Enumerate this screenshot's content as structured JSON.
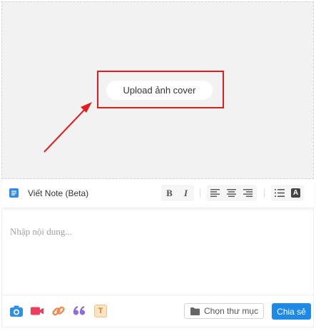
{
  "cover": {
    "upload_label": "Upload ảnh cover"
  },
  "toolbar": {
    "title": "Viết Note (Beta)",
    "bold_label": "B",
    "italic_label": "I",
    "format_a_label": "A"
  },
  "editor": {
    "placeholder": "Nhập nội dung..."
  },
  "footer": {
    "folder_label": "Chọn thư mục",
    "share_label": "Chia sẻ",
    "text_tag_label": "T"
  },
  "colors": {
    "accent": "#1e8ae8",
    "highlight": "#e31d1d"
  }
}
